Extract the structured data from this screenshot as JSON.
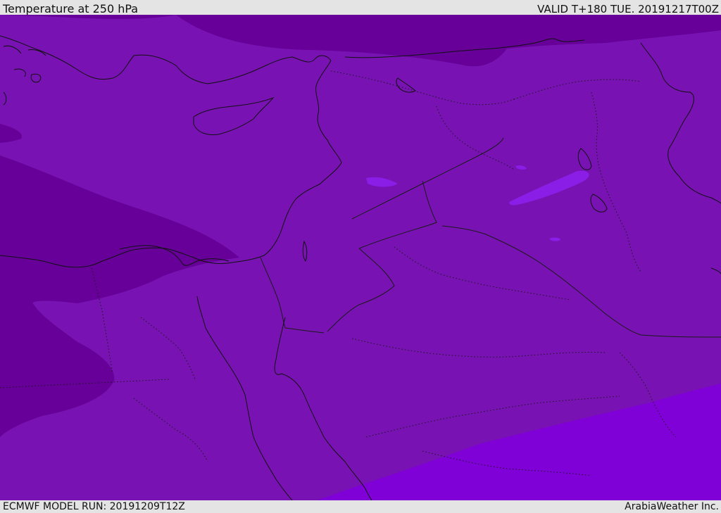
{
  "header": {
    "title": "Temperature at 250 hPa",
    "valid": "VALID T+180 TUE. 20191217T00Z"
  },
  "footer": {
    "model_run": "ECMWF MODEL RUN: 20191209T12Z",
    "credit": "ArabiaWeather Inc."
  },
  "map": {
    "colors": {
      "base": "#7812b2",
      "cold": "#660098",
      "warm": "#8000d8",
      "warm_patch": "#8a1ee6",
      "coast": "#111111",
      "border": "#1a1a1a"
    }
  }
}
